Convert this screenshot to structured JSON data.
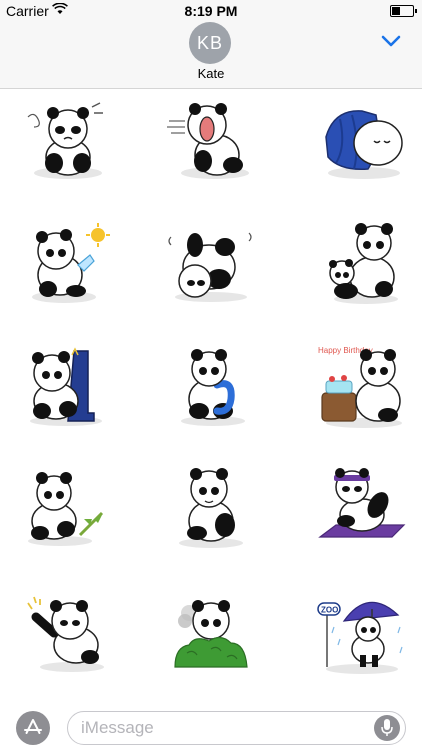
{
  "status_bar": {
    "carrier": "Carrier",
    "time": "8:19 PM"
  },
  "header": {
    "avatar_initials": "KB",
    "contact_name": "Kate",
    "collapse_icon": "chevron-down-icon",
    "accent_color": "#1a73e8"
  },
  "stickers": [
    {
      "id": "panda-annoyed",
      "row": 1,
      "col": 1
    },
    {
      "id": "panda-yawning",
      "row": 1,
      "col": 2
    },
    {
      "id": "panda-sleeping-bag",
      "row": 1,
      "col": 3
    },
    {
      "id": "panda-hot-sun",
      "row": 2,
      "col": 1
    },
    {
      "id": "panda-headstand",
      "row": 2,
      "col": 2
    },
    {
      "id": "panda-hugging-baby",
      "row": 2,
      "col": 3
    },
    {
      "id": "panda-boot",
      "row": 3,
      "col": 1
    },
    {
      "id": "panda-blue-scarf",
      "row": 3,
      "col": 2
    },
    {
      "id": "panda-birthday-cake",
      "row": 3,
      "col": 3
    },
    {
      "id": "panda-bamboo",
      "row": 4,
      "col": 1
    },
    {
      "id": "panda-sitting",
      "row": 4,
      "col": 2
    },
    {
      "id": "panda-yoga-mat",
      "row": 4,
      "col": 3
    },
    {
      "id": "panda-waving",
      "row": 5,
      "col": 1
    },
    {
      "id": "panda-bush",
      "row": 5,
      "col": 2
    },
    {
      "id": "panda-zoo-umbrella",
      "row": 5,
      "col": 3
    }
  ],
  "sticker_texts": {
    "birthday": "Happy Birthday",
    "zoo": "ZOO"
  },
  "compose": {
    "placeholder": "iMessage",
    "app_store_icon": "app-store-icon",
    "mic_icon": "microphone-icon"
  }
}
